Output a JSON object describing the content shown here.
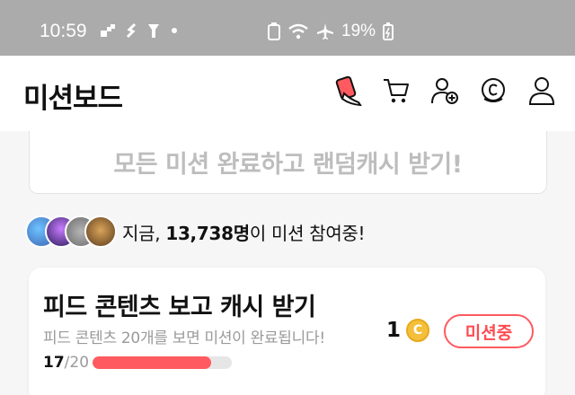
{
  "status_bar": {
    "time": "10:59",
    "battery": "19%",
    "icons_left": [
      "grid-icon",
      "s-icon",
      "flashlight-icon",
      "dot-icon"
    ],
    "icons_right": [
      "recycle-battery-icon",
      "wifi-icon",
      "airplane-icon",
      "battery-charging-icon"
    ]
  },
  "header": {
    "title": "미션보드",
    "icons": [
      "mission-card-icon",
      "cart-icon",
      "add-friend-icon",
      "coin-c-icon",
      "profile-icon"
    ]
  },
  "banner": {
    "text": "모든 미션 완료하고 랜덤캐시 받기!"
  },
  "participants": {
    "prefix": "지금, ",
    "count": "13,738명",
    "suffix": "이 미션 참여중!"
  },
  "mission": {
    "title": "피드 콘텐츠 보고 캐시 받기",
    "description": "피드 콘텐츠 20개를 보면 미션이 완료됩니다!",
    "reward_amount": "1",
    "coin_symbol": "C",
    "status": "미션중",
    "progress_current": "17",
    "progress_total": "/20",
    "progress_fraction": 0.85
  },
  "colors": {
    "accent": "#ff5a5f",
    "coin": "#f4bf3a",
    "status_bar": "#ababab"
  }
}
